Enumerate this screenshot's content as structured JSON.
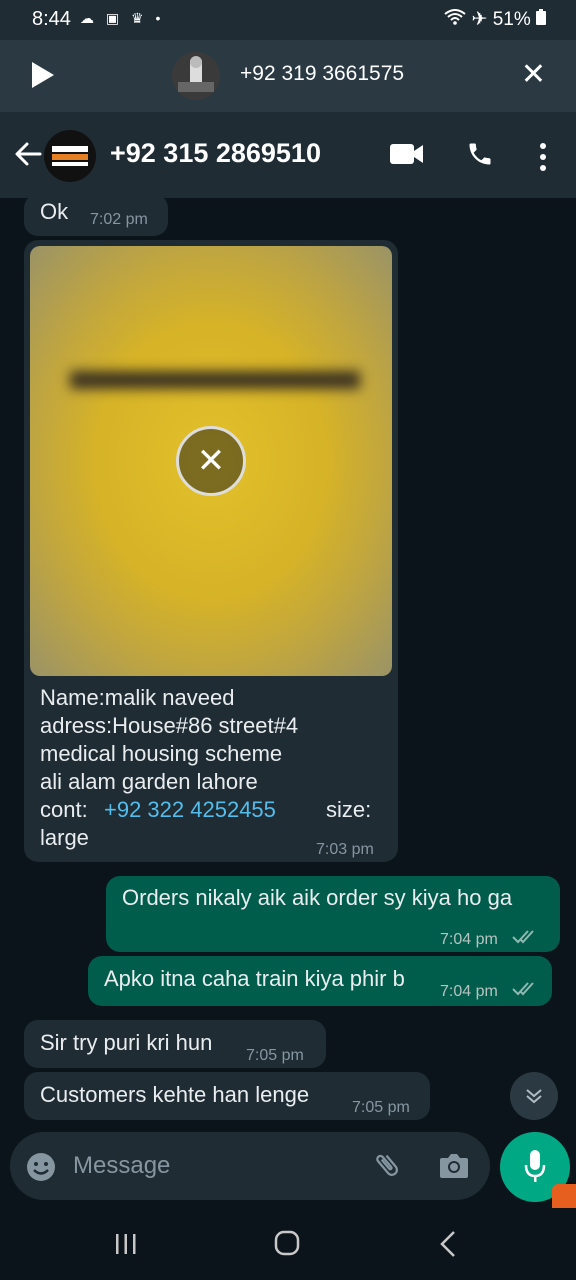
{
  "status_bar": {
    "time": "8:44",
    "notif_icons": "☁ ▣ ♛ •",
    "battery": "51%"
  },
  "ongoing_call": {
    "number": "+92 319 3661575"
  },
  "app_bar": {
    "contact": "+92 315 2869510"
  },
  "messages": [
    {
      "type": "incoming",
      "text": "Ok",
      "time": "7:02 pm"
    },
    {
      "type": "incoming_media",
      "caption_lines": [
        "Name:malik naveed",
        "adress:House#86 street#4",
        "medical housing scheme",
        "ali alam garden lahore"
      ],
      "cont_label": "cont:",
      "cont_number": "+92 322 4252455",
      "size_label": "size:",
      "size_value": "large",
      "time": "7:03 pm"
    },
    {
      "type": "outgoing",
      "text": "Orders nikaly aik aik order sy kiya ho ga",
      "time": "7:04 pm"
    },
    {
      "type": "outgoing",
      "text": "Apko itna caha train kiya phir b",
      "time": "7:04 pm"
    },
    {
      "type": "incoming",
      "text": "Sir try puri kri hun",
      "time": "7:05 pm"
    },
    {
      "type": "incoming",
      "text": "Customers kehte han lenge",
      "time": "7:05 pm"
    }
  ],
  "composer": {
    "placeholder": "Message"
  },
  "colors": {
    "accent": "#00a884",
    "outgoing_bubble": "#005c4b",
    "incoming_bubble": "#1f2c34",
    "link": "#53bdeb"
  }
}
